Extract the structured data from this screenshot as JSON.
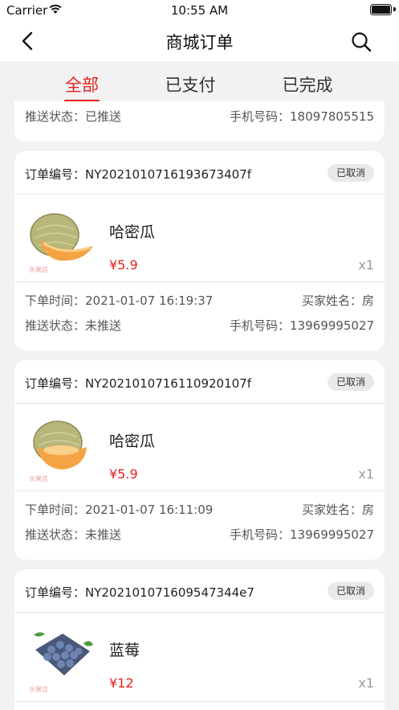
{
  "status_bar": {
    "carrier": "Carrier",
    "time": "10:55 AM"
  },
  "nav": {
    "title": "商城订单",
    "back_icon": "chevron-left-icon",
    "search_icon": "search-icon"
  },
  "tabs": [
    {
      "label": "全部",
      "active": true
    },
    {
      "label": "已支付"
    },
    {
      "label": "已完成"
    }
  ],
  "colors": {
    "accent": "#e0231e",
    "badge_bg": "#e9e9e9",
    "page_bg": "#f2f2f2"
  },
  "partial_card": {
    "push_status": "推送状态：已推送",
    "phone": "手机号码：18097805515"
  },
  "orders": [
    {
      "order_no": "订单编号：NY2021010716193673407f",
      "status": "已取消",
      "product": "哈密瓜",
      "price": "¥5.9",
      "qty": "x1",
      "time": "下单时间：2021-01-07 16:19:37",
      "buyer": "买家姓名：房",
      "push_status": "推送状态：未推送",
      "phone": "手机号码：13969995027",
      "watermark": "水果店"
    },
    {
      "order_no": "订单编号：NY2021010716110920107f",
      "status": "已取消",
      "product": "哈密瓜",
      "price": "¥5.9",
      "qty": "x1",
      "time": "下单时间：2021-01-07 16:11:09",
      "buyer": "买家姓名：房",
      "push_status": "推送状态：未推送",
      "phone": "手机号码：13969995027",
      "watermark": "水果店"
    },
    {
      "order_no": "订单编号：NY202101071609547344e7",
      "status": "已取消",
      "product": "蓝莓",
      "price": "¥12",
      "qty": "x1",
      "watermark": "水果店"
    }
  ]
}
